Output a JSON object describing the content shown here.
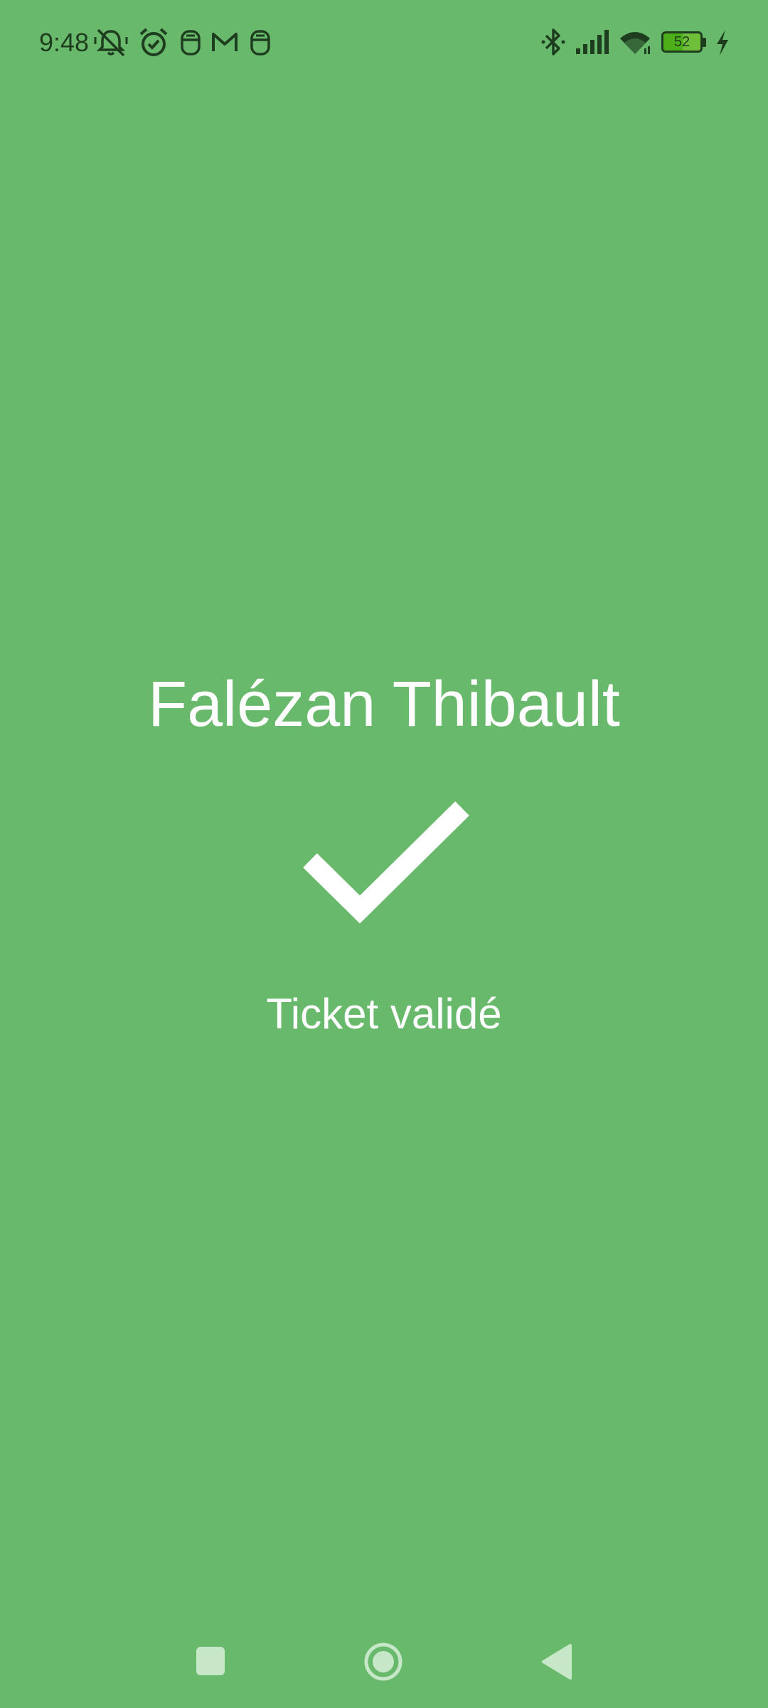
{
  "status_bar": {
    "time": "9:48",
    "battery_percent": "52",
    "battery_level": 52,
    "charging": true,
    "icons": [
      "mute-notifications-icon",
      "alarm-icon",
      "app-notification-icon",
      "gmail-icon",
      "app-notification-icon",
      "bluetooth-icon",
      "signal-icon",
      "wifi-icon",
      "battery-icon",
      "charging-icon"
    ]
  },
  "main": {
    "name": "Falézan Thibault",
    "status_message": "Ticket validé",
    "status_icon": "checkmark-icon"
  },
  "nav_bar": {
    "buttons": [
      "recents-button",
      "home-button",
      "back-button"
    ]
  },
  "colors": {
    "background": "#68b96b",
    "foreground": "#ffffff",
    "status_text": "#1e3d1f"
  }
}
